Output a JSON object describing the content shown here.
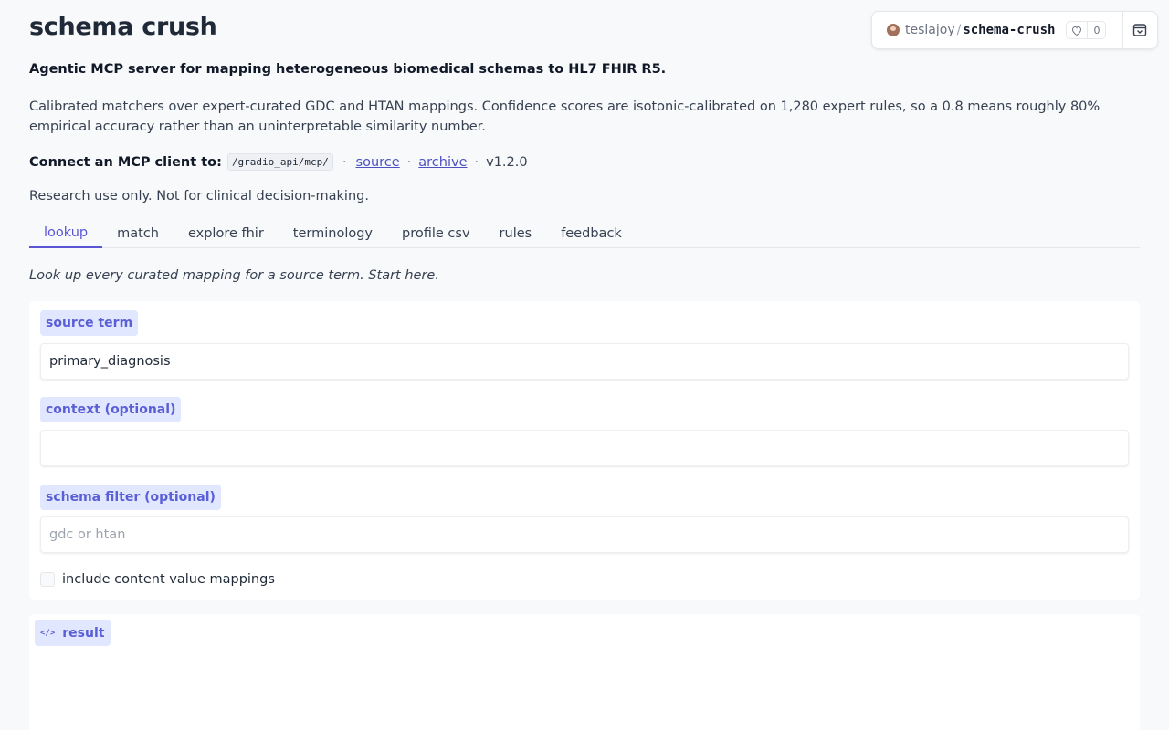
{
  "header": {
    "title": "schema crush",
    "subtitle": "Agentic MCP server for mapping heterogeneous biomedical schemas to HL7 FHIR R5.",
    "description": "Calibrated matchers over expert-curated GDC and HTAN mappings. Confidence scores are isotonic-calibrated on 1,280 expert rules, so a 0.8 means roughly 80% empirical accuracy rather than an uninterpretable similarity number.",
    "connect_label": "Connect an MCP client to:",
    "connect_path": "/gradio_api/mcp/",
    "source_link": "source",
    "archive_link": "archive",
    "version": "v1.2.0",
    "disclaimer": "Research use only. Not for clinical decision-making."
  },
  "hub_badge": {
    "owner": "teslajoy",
    "repo": "schema-crush",
    "likes": "0",
    "like_icon": "heart-icon",
    "collapse_icon": "collapse-icon"
  },
  "tabs": [
    {
      "label": "lookup",
      "active": true
    },
    {
      "label": "match"
    },
    {
      "label": "explore fhir"
    },
    {
      "label": "terminology"
    },
    {
      "label": "profile csv"
    },
    {
      "label": "rules"
    },
    {
      "label": "feedback"
    }
  ],
  "lookup": {
    "hint": "Look up every curated mapping for a source term. Start here.",
    "source_term_label": "source term",
    "source_term_value": "primary_diagnosis",
    "context_label": "context (optional)",
    "context_value": "",
    "schema_filter_label": "schema filter (optional)",
    "schema_filter_placeholder": "gdc or htan",
    "include_content_label": "include content value mappings",
    "include_content_checked": false,
    "result_label": "result"
  },
  "colors": {
    "accent": "#5b55d6",
    "label_bg": "#e0e7ff",
    "page_bg": "#f7f9fb"
  }
}
